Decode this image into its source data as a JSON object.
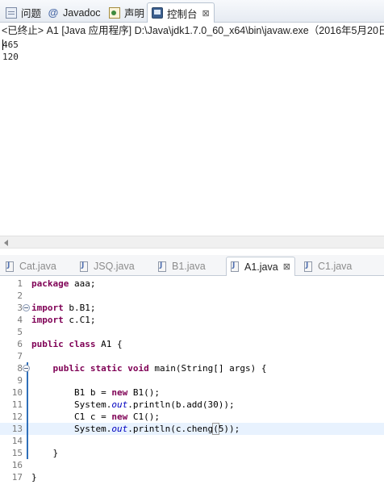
{
  "view_tabs": [
    {
      "label": "问题",
      "icon": "problems-icon"
    },
    {
      "label": "Javadoc",
      "icon": "javadoc-icon"
    },
    {
      "label": "声明",
      "icon": "declaration-icon"
    },
    {
      "label": "控制台",
      "icon": "console-icon",
      "active": true,
      "close": "⊠"
    }
  ],
  "console": {
    "description": "<已终止> A1 [Java 应用程序] D:\\Java\\jdk1.7.0_60_x64\\bin\\javaw.exe（2016年5月20日",
    "output": [
      "465",
      "120"
    ]
  },
  "editor_tabs": [
    {
      "label": "Cat.java"
    },
    {
      "label": "JSQ.java"
    },
    {
      "label": "B1.java"
    },
    {
      "label": "A1.java",
      "active": true,
      "close": "⊠"
    },
    {
      "label": "C1.java"
    }
  ],
  "code": {
    "line_numbers": [
      "1",
      "2",
      "3",
      "4",
      "5",
      "6",
      "7",
      "8",
      "9",
      "10",
      "11",
      "12",
      "13",
      "14",
      "15",
      "16",
      "17"
    ],
    "lines": {
      "l1": {
        "kw": "package",
        "rest": " aaa;"
      },
      "l3": {
        "kw": "import",
        "rest": " b.B1;"
      },
      "l4": {
        "kw": "import",
        "rest": " c.C1;"
      },
      "l6": {
        "kw1": "public",
        "kw2": "class",
        "rest": " A1 {"
      },
      "l8": {
        "kw1": "public",
        "kw2": "static",
        "kw3": "void",
        "rest": " main(String[] args) {"
      },
      "l10": {
        "pre": "B1 b = ",
        "kw": "new",
        "rest": " B1();"
      },
      "l11": {
        "pre": "System.",
        "static_field": "out",
        "rest": ".println(b.add(30));"
      },
      "l12": {
        "pre": "C1 c = ",
        "kw": "new",
        "rest": " C1();"
      },
      "l13": {
        "pre": "System.",
        "static_field": "out",
        "mid": ".println(c.cheng",
        "paren": "(",
        "rest": "5));"
      },
      "l15": {
        "text": "}"
      },
      "l17": {
        "text": "}"
      }
    }
  },
  "colors": {
    "keyword": "#7f0055",
    "static_field": "#0000c0",
    "current_line": "#e8f2fe"
  }
}
